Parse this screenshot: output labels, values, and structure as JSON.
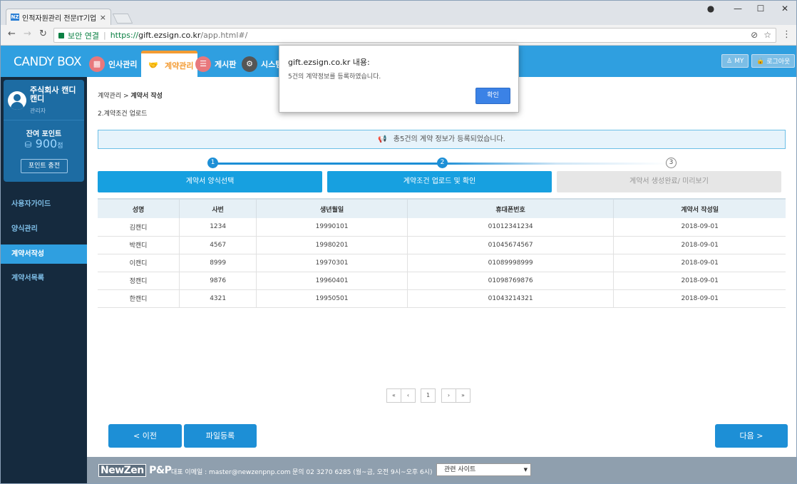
{
  "browser": {
    "tab_title": "인적자원관리 전문IT기업",
    "tab_favicon": "NZ",
    "tab_close": "×",
    "secure_label": "보안 연결",
    "url_proto": "https://",
    "url_host": "gift.ezsign.co.kr",
    "url_path": "/app.html#/",
    "controls": {
      "account": "●",
      "min": "—",
      "max": "☐",
      "close": "✕"
    }
  },
  "app": {
    "logo": "CANDY BOX",
    "menu": [
      {
        "label": "인사관리"
      },
      {
        "label": "계약관리"
      },
      {
        "label": "게시판"
      },
      {
        "label": "시스템"
      }
    ],
    "my_label": "MY",
    "logout_label": "로그아웃"
  },
  "sidebar": {
    "company": "주식회사 캔디캔디",
    "role": "관리자",
    "points_label": "잔여 포인트",
    "points_value": "900",
    "points_unit": "점",
    "charge_label": "포인트 충전",
    "items": [
      {
        "label": "사용자가이드"
      },
      {
        "label": "양식관리"
      },
      {
        "label": "계약서작성"
      },
      {
        "label": "계약서목록"
      }
    ]
  },
  "main": {
    "breadcrumb_parent": "계약관리 > ",
    "breadcrumb_current": "계약서 작성",
    "step_title": "2.계약조건 업로드",
    "notice": "총5건의 계약 정보가 등록되었습니다.",
    "steps": [
      {
        "num": "1",
        "label": "계약서 양식선택"
      },
      {
        "num": "2",
        "label": "계약조건 업로드 및 확인"
      },
      {
        "num": "3",
        "label": "계약서 생성완료/ 미리보기"
      }
    ],
    "table": {
      "headers": [
        "성명",
        "사번",
        "생년월일",
        "휴대폰번호",
        "계약서 작성일"
      ],
      "rows": [
        [
          "김캔디",
          "1234",
          "19990101",
          "01012341234",
          "2018-09-01"
        ],
        [
          "박캔디",
          "4567",
          "19980201",
          "01045674567",
          "2018-09-01"
        ],
        [
          "이캔디",
          "8999",
          "19970301",
          "01089998999",
          "2018-09-01"
        ],
        [
          "정캔디",
          "9876",
          "19960401",
          "01098769876",
          "2018-09-01"
        ],
        [
          "한캔디",
          "4321",
          "19950501",
          "01043214321",
          "2018-09-01"
        ]
      ]
    },
    "pager": {
      "first": "«",
      "prev": "‹",
      "page": "1",
      "next": "›",
      "last": "»"
    },
    "prev_button": "< 이전",
    "upload_button": "파일등록",
    "next_button": "다음 >"
  },
  "footer": {
    "logo_a": "NewZen",
    "logo_b": " P&P",
    "email": "대표 이메일 : master@newzenpnp.com",
    "phone": "문의 02 3270 6285 (월~금, 오전 9시~오후 6시)",
    "select_label": "관련 사이트"
  },
  "dialog": {
    "title": "gift.ezsign.co.kr 내용:",
    "message": "5건의 계약정보를 등록하였습니다.",
    "ok_label": "확인"
  },
  "colors": {
    "brand": "#2f9fe0",
    "sidebar": "#152a3e",
    "active_menu": "#f39b33"
  }
}
